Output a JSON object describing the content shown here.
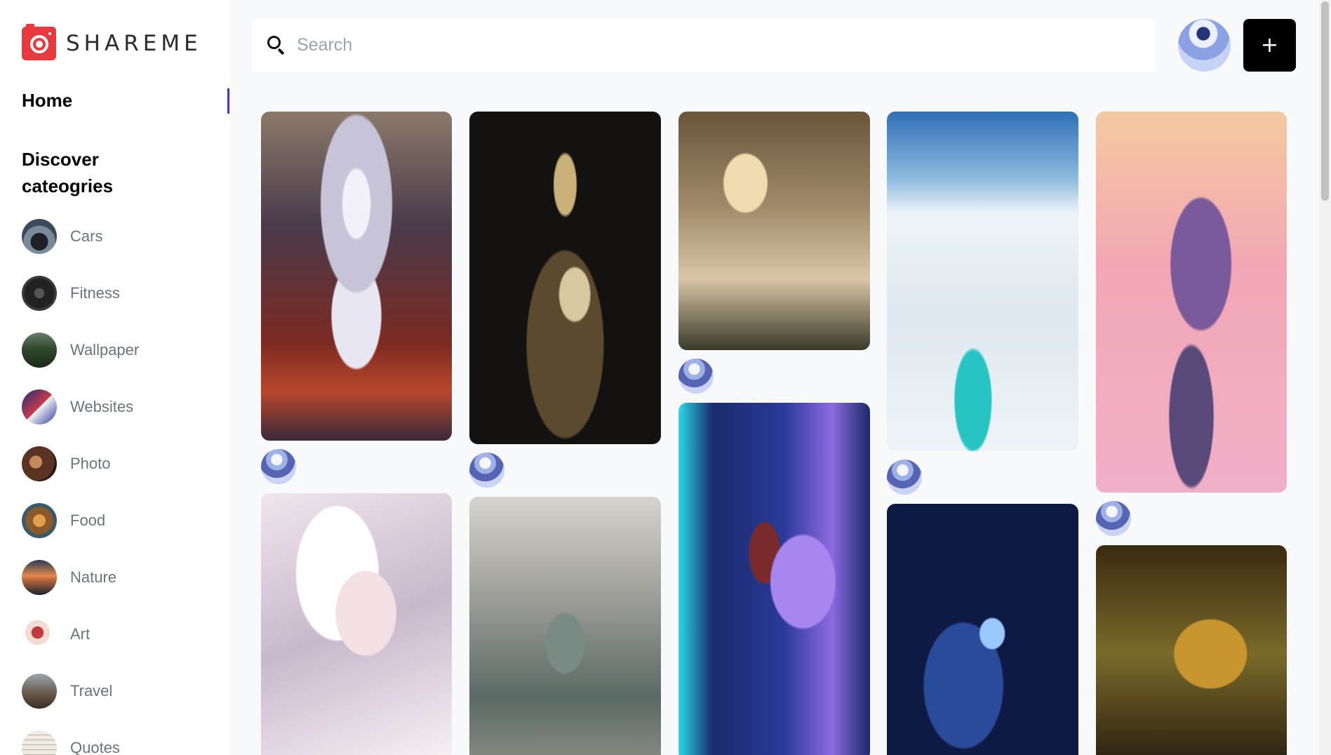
{
  "app": {
    "name": "SHAREME"
  },
  "sidebar": {
    "home_label": "Home",
    "discover_label": "Discover cateogries",
    "categories": [
      {
        "label": "Cars",
        "color": "#3d4a5a"
      },
      {
        "label": "Fitness",
        "color": "#2a2a2a"
      },
      {
        "label": "Wallpaper",
        "color": "#3f5a3a"
      },
      {
        "label": "Websites",
        "color": "#1d2d7a"
      },
      {
        "label": "Photo",
        "color": "#5a3322"
      },
      {
        "label": "Food",
        "color": "#8a5a2a"
      },
      {
        "label": "Nature",
        "color": "#c06a3a"
      },
      {
        "label": "Art",
        "color": "#c23a3a"
      },
      {
        "label": "Travel",
        "color": "#6a5a4a"
      },
      {
        "label": "Quotes",
        "color": "#d8d2c8"
      }
    ]
  },
  "search": {
    "placeholder": "Search",
    "value": ""
  },
  "header": {
    "add_button_label": "+"
  },
  "pins": [
    {
      "subject": "anime-angel-art",
      "colors": [
        "#3b2a3a",
        "#c7c4d8",
        "#b8462b"
      ]
    },
    {
      "subject": "fantasy-girl-dark",
      "colors": [
        "#141210",
        "#5b4a2e",
        "#c9b27a"
      ]
    },
    {
      "subject": "desk-setup",
      "colors": [
        "#6a553a",
        "#d8c6a6",
        "#3a3a2a"
      ]
    },
    {
      "subject": "frozen-lake",
      "colors": [
        "#2f6fb6",
        "#eef3f8",
        "#27c4c4"
      ]
    },
    {
      "subject": "pink-fantasy",
      "colors": [
        "#f3a7b4",
        "#7a5a9a",
        "#f4c9a0"
      ]
    },
    {
      "subject": "white-hair-girl",
      "colors": [
        "#efe6ec",
        "#c8b8cc",
        "#f7f1f3"
      ]
    },
    {
      "subject": "city-girl",
      "colors": [
        "#9a9a96",
        "#5a6a64",
        "#d6d4ce"
      ]
    },
    {
      "subject": "night-landscape",
      "colors": [
        "#1a2a6a",
        "#8c6ae0",
        "#2ad8e6"
      ]
    },
    {
      "subject": "blue-night-girl",
      "colors": [
        "#0e1a44",
        "#2a4a9a",
        "#9ac8ff"
      ]
    },
    {
      "subject": "golden-ruins",
      "colors": [
        "#3a2a10",
        "#c9962e",
        "#7a6a2a"
      ]
    }
  ]
}
